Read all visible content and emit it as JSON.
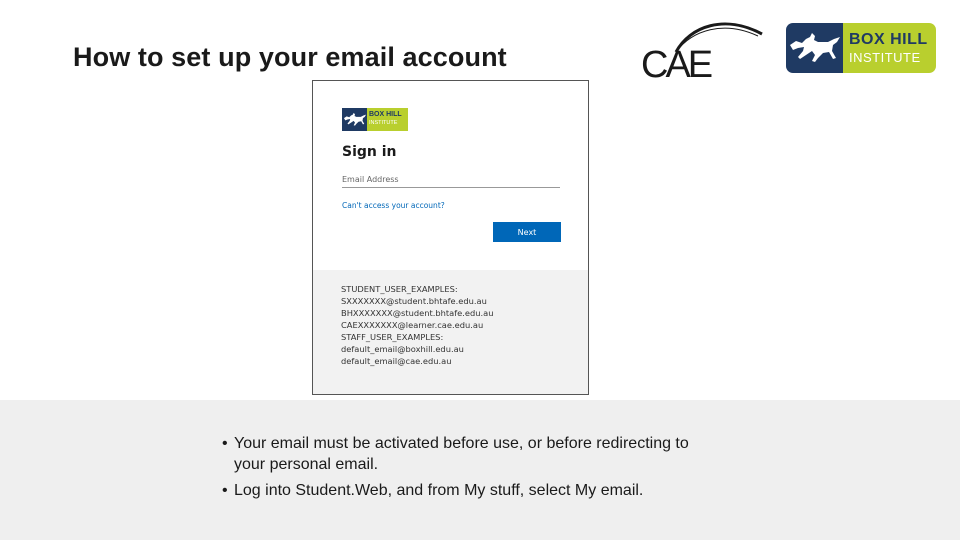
{
  "slide": {
    "title": "How to set up your email account"
  },
  "logos": {
    "cae": {
      "text": "CAE",
      "icon": "cae-swoosh-icon"
    },
    "boxhill": {
      "line1": "BOX HILL",
      "line2": "INSTITUTE",
      "icon": "horse-icon",
      "colors": {
        "navy": "#1f3a63",
        "lime": "#b9cf2e"
      }
    }
  },
  "signin": {
    "logo_line1": "BOX HILL",
    "logo_line2": "INSTITUTE",
    "heading": "Sign in",
    "email_placeholder": "Email Address",
    "cant_access": "Can't access your account?",
    "next_label": "Next",
    "accent": "#0067b8",
    "hints": [
      "STUDENT_USER_EXAMPLES:",
      "SXXXXXXX@student.bhtafe.edu.au",
      "BHXXXXXXX@student.bhtafe.edu.au",
      "CAEXXXXXXX@learner.cae.edu.au",
      "STAFF_USER_EXAMPLES:",
      "default_email@boxhill.edu.au",
      "default_email@cae.edu.au"
    ]
  },
  "bullets": [
    {
      "marker": "•",
      "text": "Your email must be activated before use, or before redirecting to your personal email."
    },
    {
      "marker": "•",
      "text": "Log into Student.Web, and from My stuff, select My email."
    }
  ]
}
